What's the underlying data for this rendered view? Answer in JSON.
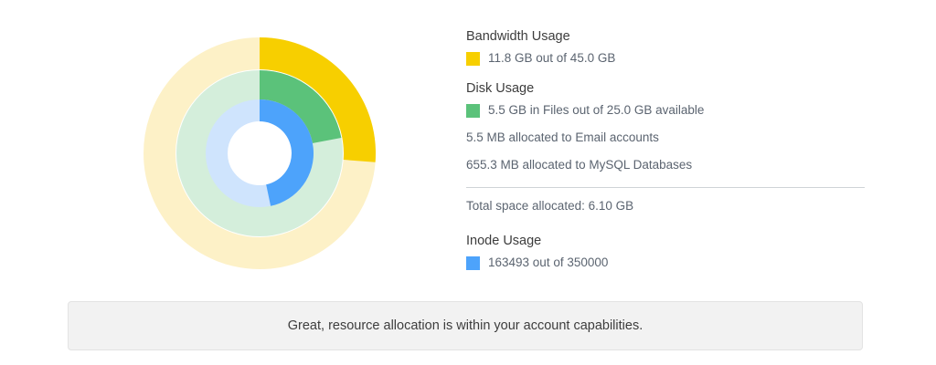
{
  "chart_data": {
    "type": "pie",
    "rings": [
      {
        "name": "Bandwidth Usage",
        "used": 11.8,
        "total": 45.0,
        "color": "#f7cf00",
        "track": "#fdf1c7"
      },
      {
        "name": "Disk Usage",
        "used": 5.5,
        "total": 25.0,
        "color": "#5bc27a",
        "track": "#d4eedb"
      },
      {
        "name": "Inode Usage",
        "used": 163493,
        "total": 350000,
        "color": "#4da3fb",
        "track": "#cfe4fd"
      }
    ]
  },
  "bandwidth": {
    "title": "Bandwidth Usage",
    "detail": "11.8 GB out of 45.0 GB",
    "color": "#f7cf00"
  },
  "disk": {
    "title": "Disk Usage",
    "detail": "5.5 GB in Files out of 25.0 GB available",
    "color": "#5bc27a",
    "email": "5.5 MB allocated to Email accounts",
    "mysql": "655.3 MB allocated to MySQL Databases"
  },
  "total": "Total space allocated: 6.10 GB",
  "inode": {
    "title": "Inode Usage",
    "detail": "163493 out of 350000",
    "color": "#4da3fb"
  },
  "notice": "Great, resource allocation is within your account capabilities."
}
